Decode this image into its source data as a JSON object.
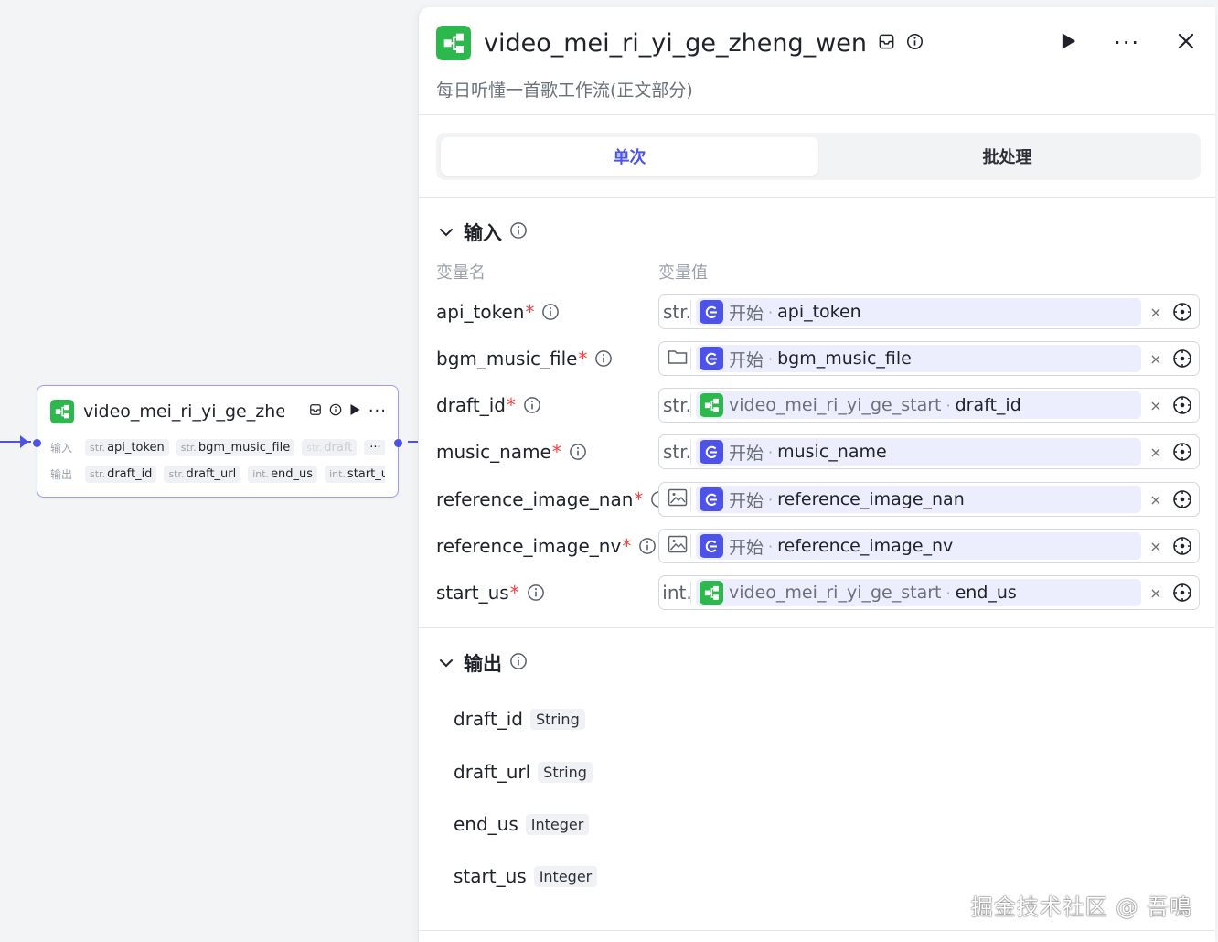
{
  "node": {
    "title": "video_mei_ri_yi_ge_zhe···",
    "input_label": "输入",
    "output_label": "输出",
    "inputs": [
      {
        "type": "str.",
        "name": "api_token"
      },
      {
        "type": "str.",
        "name": "bgm_music_file"
      },
      {
        "type": "str.",
        "name": "draft"
      }
    ],
    "more_label": "···",
    "outputs": [
      {
        "type": "str.",
        "name": "draft_id"
      },
      {
        "type": "str.",
        "name": "draft_url"
      },
      {
        "type": "int.",
        "name": "end_us"
      },
      {
        "type": "int.",
        "name": "start_us"
      }
    ]
  },
  "panel": {
    "title": "video_mei_ri_yi_ge_zheng_wen",
    "description": "每日听懂一首歌工作流(正文部分)",
    "more_label": "···",
    "tabs": [
      {
        "label": "单次",
        "active": true
      },
      {
        "label": "批处理",
        "active": false
      }
    ],
    "inputs_section": {
      "title": "输入",
      "col_name": "变量名",
      "col_value": "变量值",
      "rows": [
        {
          "name": "api_token",
          "type": "str.",
          "source": "start",
          "node": "开始",
          "var": "api_token"
        },
        {
          "name": "bgm_music_file",
          "type": "folder",
          "source": "start",
          "node": "开始",
          "var": "bgm_music_file"
        },
        {
          "name": "draft_id",
          "type": "str.",
          "source": "wf",
          "node": "video_mei_ri_yi_ge_start",
          "var": "draft_id"
        },
        {
          "name": "music_name",
          "type": "str.",
          "source": "start",
          "node": "开始",
          "var": "music_name"
        },
        {
          "name": "reference_image_nan",
          "type": "image",
          "source": "start",
          "node": "开始",
          "var": "reference_image_nan"
        },
        {
          "name": "reference_image_nv",
          "type": "image",
          "source": "start",
          "node": "开始",
          "var": "reference_image_nv"
        },
        {
          "name": "start_us",
          "type": "int.",
          "source": "wf",
          "node": "video_mei_ri_yi_ge_start",
          "var": "end_us"
        }
      ],
      "required_mark": "*",
      "separator": "·",
      "clear_label": "×"
    },
    "outputs_section": {
      "title": "输出",
      "rows": [
        {
          "name": "draft_id",
          "type": "String"
        },
        {
          "name": "draft_url",
          "type": "String"
        },
        {
          "name": "end_us",
          "type": "Integer"
        },
        {
          "name": "start_us",
          "type": "Integer"
        }
      ]
    }
  },
  "watermark": "掘金技术社区 @ 吾鳴",
  "colors": {
    "accent": "#4d53e8",
    "workflow_green": "#2db84d",
    "required": "#f53f3f"
  }
}
